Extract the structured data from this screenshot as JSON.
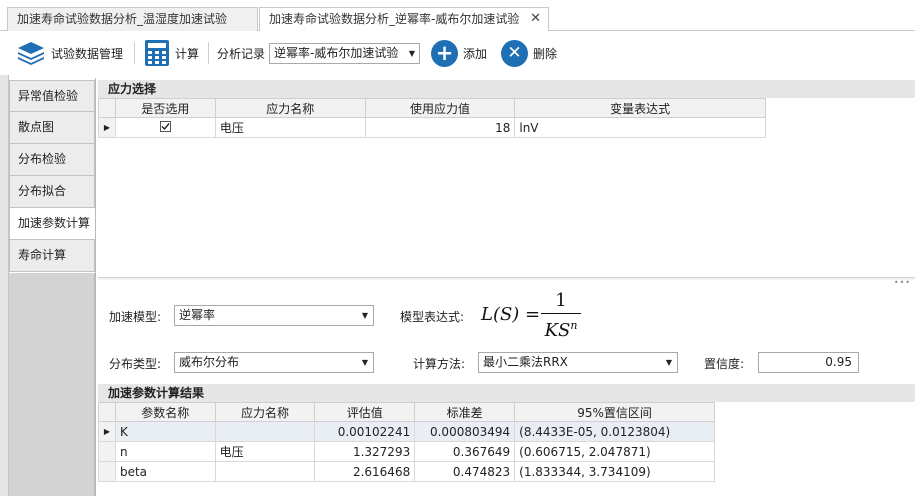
{
  "tabs": [
    {
      "label": "加速寿命试验数据分析_温湿度加速试验"
    },
    {
      "label": "加速寿命试验数据分析_逆幂率-威布尔加速试验",
      "close": "✕"
    }
  ],
  "toolbar": {
    "manage_label": "试验数据管理",
    "calc_label": "计算",
    "record_label": "分析记录",
    "record_value": "逆幂率-威布尔加速试验",
    "add_label": "添加",
    "delete_label": "删除"
  },
  "nav": {
    "items": [
      {
        "label": "异常值检验"
      },
      {
        "label": "散点图"
      },
      {
        "label": "分布检验"
      },
      {
        "label": "分布拟合"
      },
      {
        "label": "加速参数计算",
        "active": true
      },
      {
        "label": "寿命计算"
      }
    ]
  },
  "stress": {
    "title": "应力选择",
    "columns": [
      "是否选用",
      "应力名称",
      "使用应力值",
      "变量表达式"
    ],
    "rows": [
      {
        "selected": true,
        "name": "电压",
        "value": "18",
        "expr": "lnV"
      }
    ]
  },
  "form": {
    "model_label": "加速模型:",
    "model_value": "逆幂率",
    "expr_label": "模型表达式:",
    "formula_lhs": "L(S) =",
    "formula_num": "1",
    "formula_den": "KS",
    "formula_exp": "n",
    "dist_label": "分布类型:",
    "dist_value": "威布尔分布",
    "method_label": "计算方法:",
    "method_value": "最小二乘法RRX",
    "conf_label": "置信度:",
    "conf_value": "0.95"
  },
  "results": {
    "title": "加速参数计算结果",
    "columns": [
      "参数名称",
      "应力名称",
      "评估值",
      "标准差",
      "95%置信区间"
    ],
    "rows": [
      {
        "param": "K",
        "stress": "",
        "estimate": "0.00102241",
        "std": "0.000803494",
        "ci": "(8.4433E-05, 0.0123804)"
      },
      {
        "param": "n",
        "stress": "电压",
        "estimate": "1.327293",
        "std": "0.367649",
        "ci": "(0.606715, 2.047871)"
      },
      {
        "param": "beta",
        "stress": "",
        "estimate": "2.616468",
        "std": "0.474823",
        "ci": "(1.833344, 3.734109)"
      }
    ]
  },
  "colors": {
    "accent": "#1f6fb5",
    "selected_row": "#e9eef4"
  }
}
